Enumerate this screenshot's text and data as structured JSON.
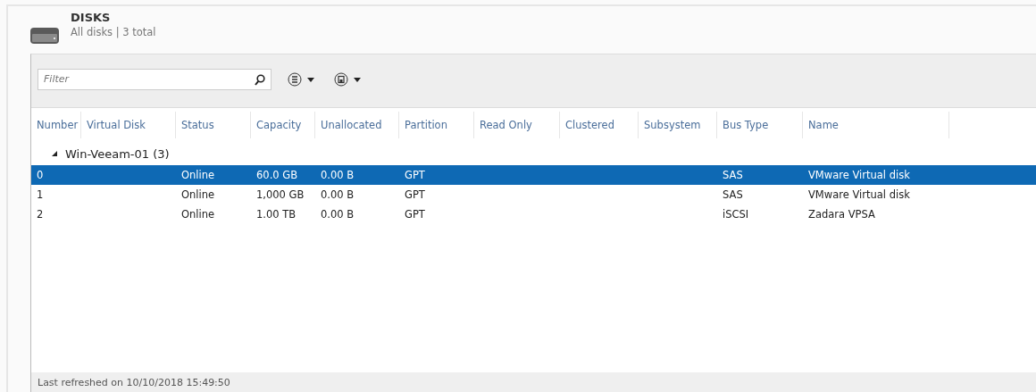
{
  "header": {
    "title": "DISKS",
    "subtitle": "All disks | 3 total"
  },
  "toolbar": {
    "filter": {
      "placeholder": "Filter"
    }
  },
  "table": {
    "columns": [
      "Number",
      "Virtual Disk",
      "Status",
      "Capacity",
      "Unallocated",
      "Partition",
      "Read Only",
      "Clustered",
      "Subsystem",
      "Bus Type",
      "Name"
    ],
    "groups": [
      {
        "label": "Win-Veeam-01 (3)",
        "expanded": true,
        "rows": [
          {
            "selected": true,
            "cells": [
              "0",
              "",
              "Online",
              "60.0 GB",
              "0.00 B",
              "GPT",
              "",
              "",
              "",
              "SAS",
              "VMware Virtual disk"
            ]
          },
          {
            "selected": false,
            "cells": [
              "1",
              "",
              "Online",
              "1,000 GB",
              "0.00 B",
              "GPT",
              "",
              "",
              "",
              "SAS",
              "VMware Virtual disk"
            ]
          },
          {
            "selected": false,
            "cells": [
              "2",
              "",
              "Online",
              "1.00 TB",
              "0.00 B",
              "GPT",
              "",
              "",
              "",
              "iSCSI",
              "Zadara VPSA"
            ]
          }
        ]
      }
    ]
  },
  "status_bar": "Last refreshed on 10/10/2018 15:49:50"
}
